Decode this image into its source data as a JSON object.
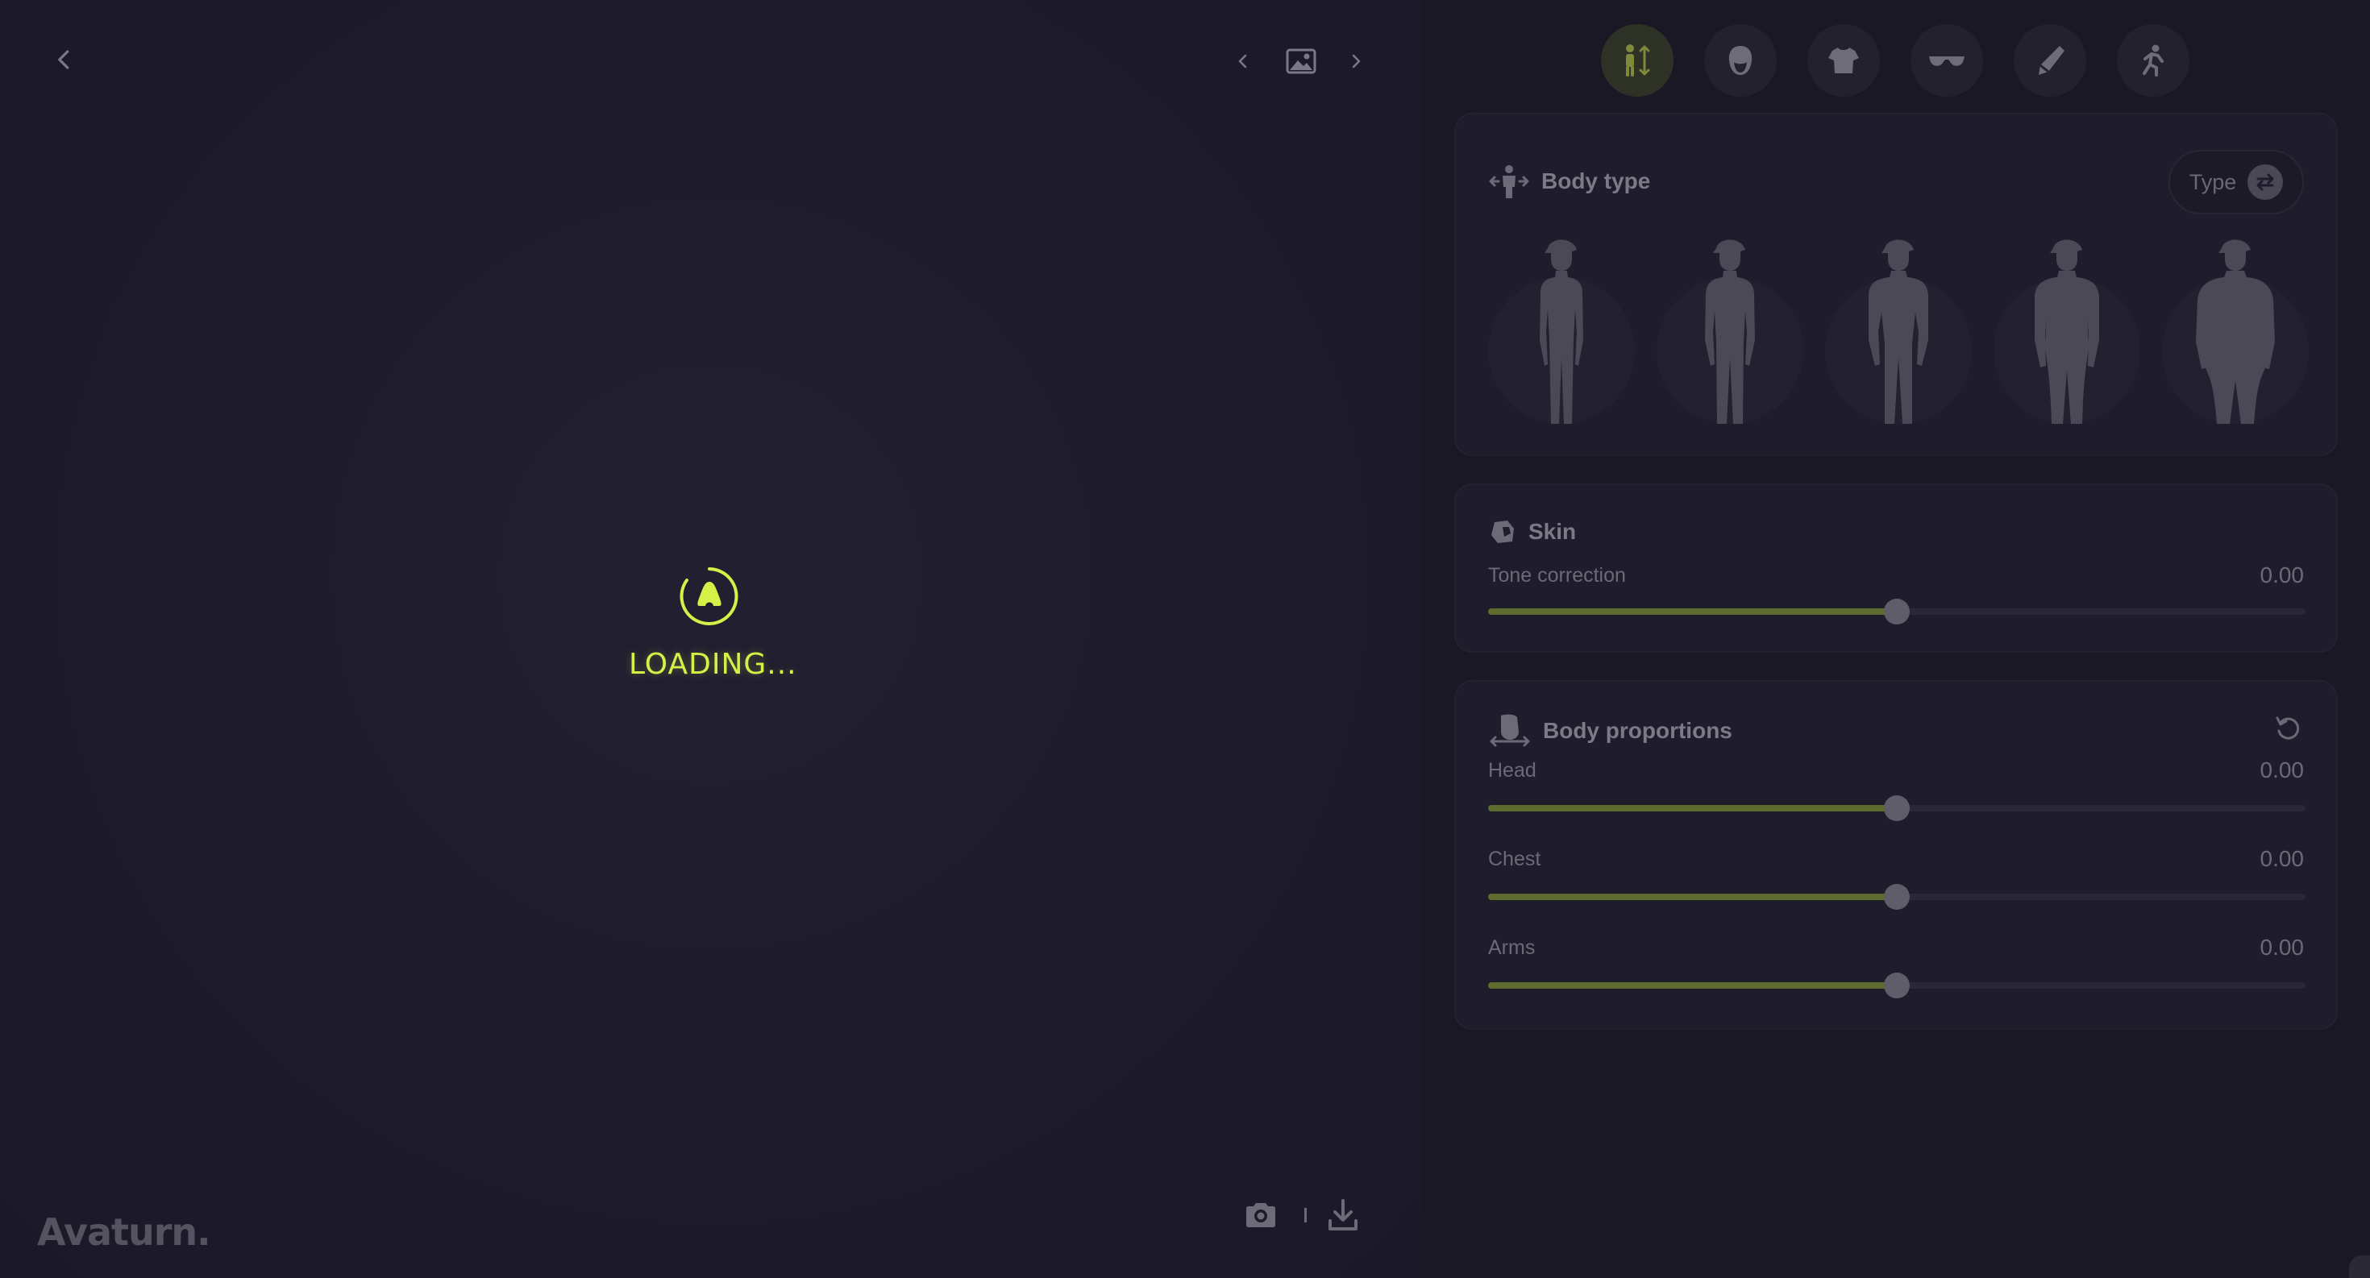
{
  "brand": {
    "name": "Avaturn."
  },
  "loader": {
    "text": "LOADING..."
  },
  "colors": {
    "accent": "#d6f048",
    "slider_fill": "#5e6b2e",
    "panel_bg": "#1a1824",
    "card_bg": "#1f1d2b"
  },
  "tabs": [
    {
      "icon": "body-icon",
      "active": true
    },
    {
      "icon": "head-icon",
      "active": false
    },
    {
      "icon": "tshirt-icon",
      "active": false
    },
    {
      "icon": "glasses-icon",
      "active": false
    },
    {
      "icon": "brush-icon",
      "active": false
    },
    {
      "icon": "run-icon",
      "active": false
    }
  ],
  "body_type": {
    "title": "Body type",
    "type_button": "Type",
    "options": [
      "slim",
      "average",
      "athletic",
      "heavy",
      "plus"
    ]
  },
  "skin": {
    "title": "Skin",
    "sliders": [
      {
        "label": "Tone correction",
        "value": "0.00",
        "position": 0.5
      }
    ]
  },
  "body_proportions": {
    "title": "Body proportions",
    "sliders": [
      {
        "label": "Head",
        "value": "0.00",
        "position": 0.5
      },
      {
        "label": "Chest",
        "value": "0.00",
        "position": 0.5
      },
      {
        "label": "Arms",
        "value": "0.00",
        "position": 0.5
      }
    ]
  }
}
